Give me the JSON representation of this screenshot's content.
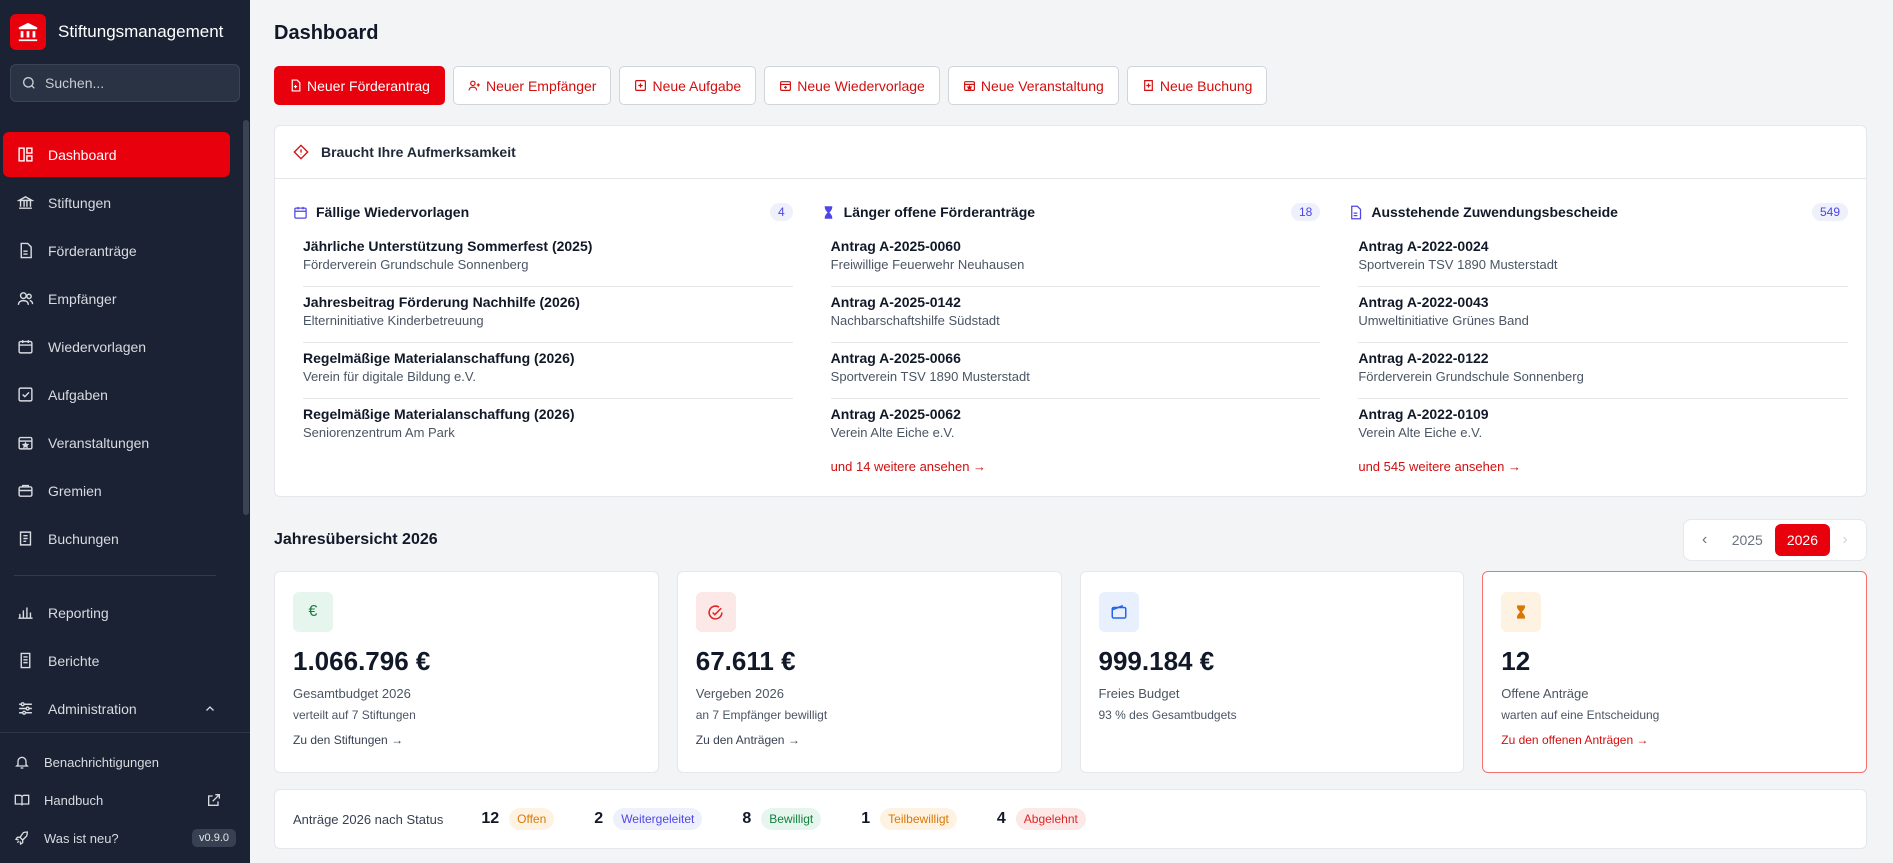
{
  "app": {
    "title": "Stiftungsmanagement"
  },
  "search": {
    "placeholder": "Suchen..."
  },
  "sidebar": {
    "items": [
      {
        "label": "Dashboard",
        "icon": "dashboard-icon"
      },
      {
        "label": "Stiftungen",
        "icon": "bank-icon"
      },
      {
        "label": "Förderanträge",
        "icon": "document-icon"
      },
      {
        "label": "Empfänger",
        "icon": "users-icon"
      },
      {
        "label": "Wiedervorlagen",
        "icon": "calendar-icon"
      },
      {
        "label": "Aufgaben",
        "icon": "checkbox-icon"
      },
      {
        "label": "Veranstaltungen",
        "icon": "event-icon"
      },
      {
        "label": "Gremien",
        "icon": "briefcase-icon"
      },
      {
        "label": "Buchungen",
        "icon": "receipt-icon"
      },
      {
        "label": "Reporting",
        "icon": "bar-chart-icon"
      },
      {
        "label": "Berichte",
        "icon": "report-icon"
      },
      {
        "label": "Administration",
        "icon": "sliders-icon"
      }
    ],
    "footer": {
      "notifications": "Benachrichtigungen",
      "handbook": "Handbuch",
      "whats_new": "Was ist neu?",
      "version": "v0.9.0"
    }
  },
  "page": {
    "title": "Dashboard"
  },
  "actions": {
    "new_application": "Neuer Förderantrag",
    "new_recipient": "Neuer Empfänger",
    "new_task": "Neue Aufgabe",
    "new_followup": "Neue Wiedervorlage",
    "new_event": "Neue Veranstaltung",
    "new_booking": "Neue Buchung"
  },
  "attention": {
    "title": "Braucht Ihre Aufmerksamkeit",
    "columns": [
      {
        "title": "Fällige Wiedervorlagen",
        "count": "4",
        "rows": [
          {
            "title": "Jährliche Unterstützung Sommerfest (2025)",
            "sub": "Förderverein Grundschule Sonnenberg"
          },
          {
            "title": "Jahresbeitrag Förderung Nachhilfe (2026)",
            "sub": "Elterninitiative Kinderbetreuung"
          },
          {
            "title": "Regelmäßige Materialanschaffung (2026)",
            "sub": "Verein für digitale Bildung e.V."
          },
          {
            "title": "Regelmäßige Materialanschaffung (2026)",
            "sub": "Seniorenzentrum Am Park"
          }
        ],
        "more": ""
      },
      {
        "title": "Länger offene Förderanträge",
        "count": "18",
        "rows": [
          {
            "title": "Antrag A-2025-0060",
            "sub": "Freiwillige Feuerwehr Neuhausen"
          },
          {
            "title": "Antrag A-2025-0142",
            "sub": "Nachbarschaftshilfe Südstadt"
          },
          {
            "title": "Antrag A-2025-0066",
            "sub": "Sportverein TSV 1890 Musterstadt"
          },
          {
            "title": "Antrag A-2025-0062",
            "sub": "Verein Alte Eiche e.V."
          }
        ],
        "more": "und 14 weitere ansehen →"
      },
      {
        "title": "Ausstehende Zuwendungsbescheide",
        "count": "549",
        "rows": [
          {
            "title": "Antrag A-2022-0024",
            "sub": "Sportverein TSV 1890 Musterstadt"
          },
          {
            "title": "Antrag A-2022-0043",
            "sub": "Umweltinitiative Grünes Band"
          },
          {
            "title": "Antrag A-2022-0122",
            "sub": "Förderverein Grundschule Sonnenberg"
          },
          {
            "title": "Antrag A-2022-0109",
            "sub": "Verein Alte Eiche e.V."
          }
        ],
        "more": "und 545 weitere ansehen →"
      }
    ]
  },
  "year": {
    "title": "Jahresübersicht 2026",
    "prev_year": "2025",
    "current_year": "2026"
  },
  "kpis": [
    {
      "icon": "€",
      "value": "1.066.796 €",
      "label": "Gesamtbudget 2026",
      "sub": "verteilt auf 7 Stiftungen",
      "link": "Zu den Stiftungen →"
    },
    {
      "icon": "check-circle",
      "value": "67.611 €",
      "label": "Vergeben 2026",
      "sub": "an 7 Empfänger bewilligt",
      "link": "Zu den Anträgen →"
    },
    {
      "icon": "wallet",
      "value": "999.184 €",
      "label": "Freies Budget",
      "sub": "93 % des Gesamtbudgets",
      "link": ""
    },
    {
      "icon": "hourglass",
      "value": "12",
      "label": "Offene Anträge",
      "sub": "warten auf eine Entscheidung",
      "link": "Zu den offenen Anträgen →"
    }
  ],
  "status": {
    "label": "Anträge 2026 nach Status",
    "items": [
      {
        "count": "12",
        "label": "Offen",
        "bg": "#fef3e2",
        "fg": "#d97706"
      },
      {
        "count": "2",
        "label": "Weitergeleitet",
        "bg": "#eef0fb",
        "fg": "#4f46e5"
      },
      {
        "count": "8",
        "label": "Bewilligt",
        "bg": "#e6f6ee",
        "fg": "#15803d"
      },
      {
        "count": "1",
        "label": "Teilbewilligt",
        "bg": "#fef3e2",
        "fg": "#d97706"
      },
      {
        "count": "4",
        "label": "Abgelehnt",
        "bg": "#fde8e8",
        "fg": "#dc2626"
      }
    ]
  },
  "colors": {
    "accent": "#e8000d",
    "sidebar": "#1a2233"
  }
}
